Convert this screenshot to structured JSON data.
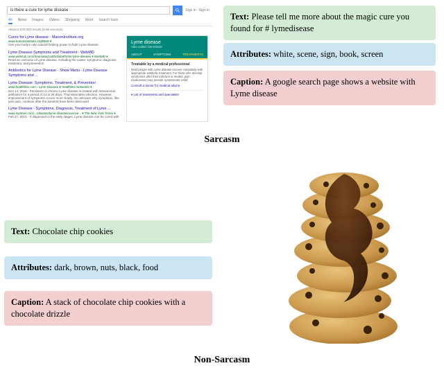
{
  "top": {
    "text_label": "Text:",
    "text_value": "Please tell me more about the magic cure you found for # lymedisease",
    "attr_label": "Attributes:",
    "attr_value": "white, scene, sign, book, screen",
    "cap_label": "Caption:",
    "cap_value": "A google search page shows a website with Lyme disease"
  },
  "bottom": {
    "text_label": "Text:",
    "text_value": "Chocolate chip cookies",
    "attr_label": "Attributes:",
    "attr_value": "dark, brown, nuts, black, food",
    "cap_label": "Caption:",
    "cap_value": "A stack of chocolate chip cookies with a chocolate drizzle"
  },
  "sections": {
    "sarcasm": "Sarcasm",
    "nonsarcasm": "Non-Sarcasm"
  },
  "gsearch": {
    "query": "is there a cure for lyme disease",
    "signin_a": "Sign in",
    "signin_b": "Sign in",
    "tabs": {
      "all": "All",
      "news": "News",
      "images": "Images",
      "videos": "Videos",
      "shopping": "Shopping",
      "more": "More",
      "tools": "Search tools"
    },
    "count": "About 1,070,000 results (0.66 seconds)",
    "results": [
      {
        "title": "Cures for Lyme disease - MarionInstitute.org",
        "url": "www.marioninstitute.org/BMS ▾",
        "snip": "Use your body's own natural healing power to fight Lyme disease."
      },
      {
        "title": "Lyme Disease Symptoms and Treatment - WebMD",
        "url": "www.webmd.com/rheumatoid-arthritis/arthritis-lyme-disease ▾ WebMD ▾",
        "snip": "Read an overview of Lyme disease, including the cause, symptoms, diagnosis, treatment, and prevention."
      },
      {
        "title": "Antibiotics for Lyme Disease - Show Menu - Lyme Disease Symptoms and ...",
        "url": "",
        "snip": ""
      },
      {
        "title": "Lyme Disease: Symptoms, Treatment, & Prevention",
        "url": "www.healthline.com › Lyme Disease ▾ Healthline Networks ▾",
        "snip": "Dec 14, 2015 - Persistent or chronic Lyme disease is treated with intravenous antibiotics for a period of 14 to 28 days. That eliminates infection. However, improvement of symptoms occurs more slowly. It's unknown why symptoms, like joint pain, continue after the bacteria have been destroyed."
      },
      {
        "title": "Lyme Disease - Symptoms, Diagnosis, Treatment of Lyme ...",
        "url": "www.nytimes.com/.../disease/lyme-disease/overvie... ▾ The New York Times ▾",
        "snip": "Feb 27, 2013 - If diagnosed in the early stages, Lyme disease can be cured with"
      }
    ],
    "kp": {
      "title": "Lyme disease",
      "sub": "Also called: borreliosis",
      "tabs": {
        "about": "ABOUT",
        "symptoms": "SYMPTOMS",
        "treatments": "TREATMENTS"
      },
      "h": "Treatable by a medical professional",
      "p": "Most people with Lyme disease recover completely with appropriate antibiotic treatment. For those who develop syndromes after their infection is treated, pain medications may provide symptomatic relief.",
      "consult": "Consult a doctor for medical advice",
      "list": "▾ List of treatments and specialists"
    }
  }
}
